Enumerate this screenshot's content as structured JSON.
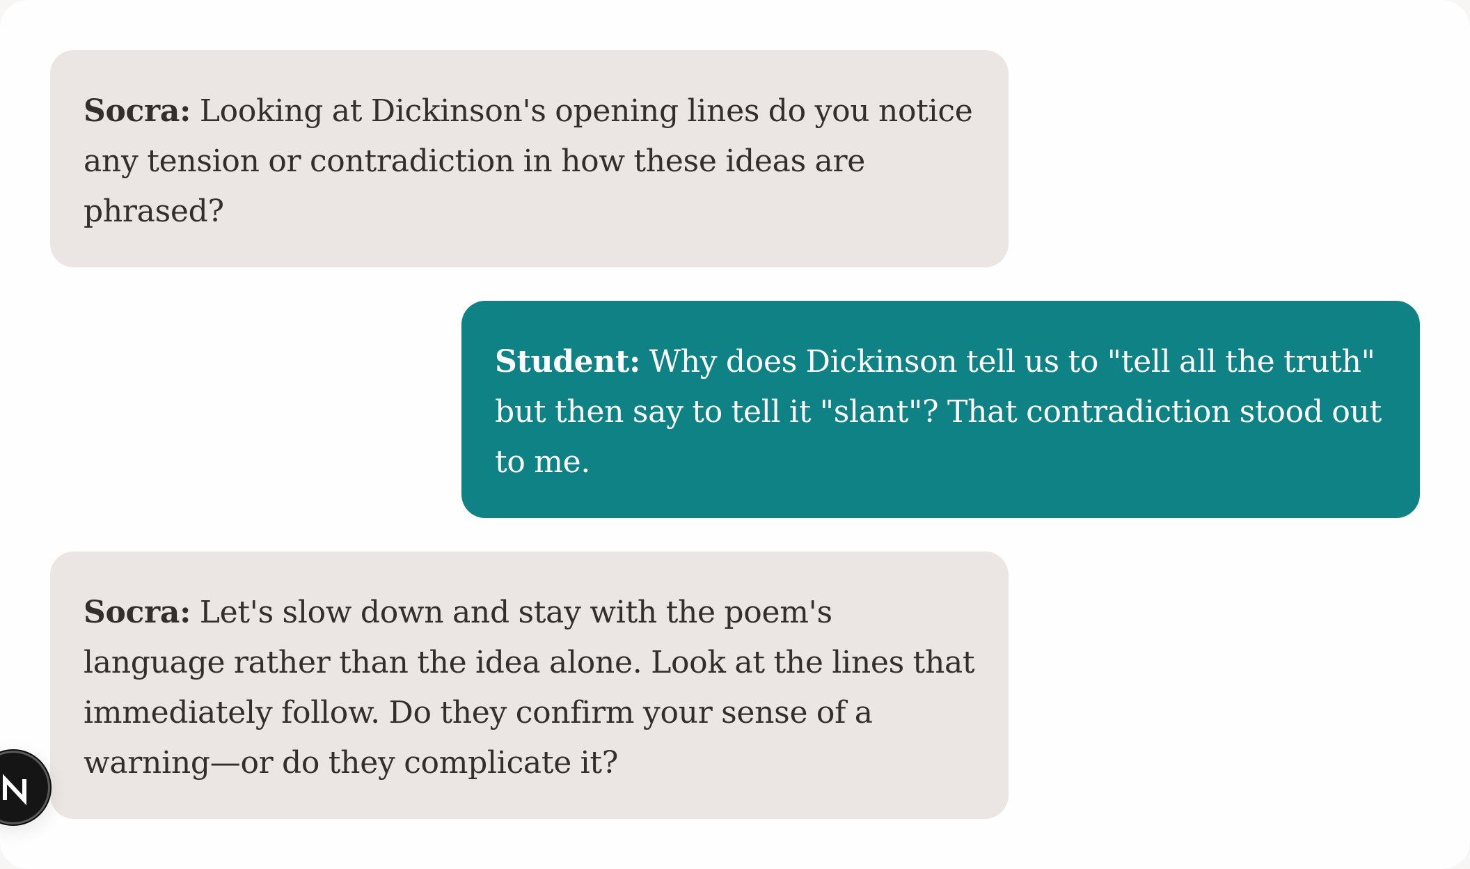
{
  "conversation": {
    "messages": [
      {
        "role": "tutor",
        "speaker": "Socra:",
        "text": "Looking at Dickinson's opening lines do you notice any tension or contradiction in how these ideas are phrased?"
      },
      {
        "role": "student",
        "speaker": "Student:",
        "text": "Why does Dickinson tell us to \"tell all the truth\" but then say to tell it \"slant\"? That contradiction stood out to me."
      },
      {
        "role": "tutor",
        "speaker": "Socra:",
        "text": "Let's slow down and stay with the poem's language rather than the idea alone. Look at the lines that immediately follow. Do they confirm your sense of a warning—or do they complicate it?"
      }
    ]
  },
  "colors": {
    "tutor_bubble": "#ebe6e3",
    "student_bubble": "#0f8286",
    "tutor_text": "#332e2c",
    "student_text": "#ffffff"
  },
  "dev_indicator": {
    "icon": "next-logo-icon"
  }
}
